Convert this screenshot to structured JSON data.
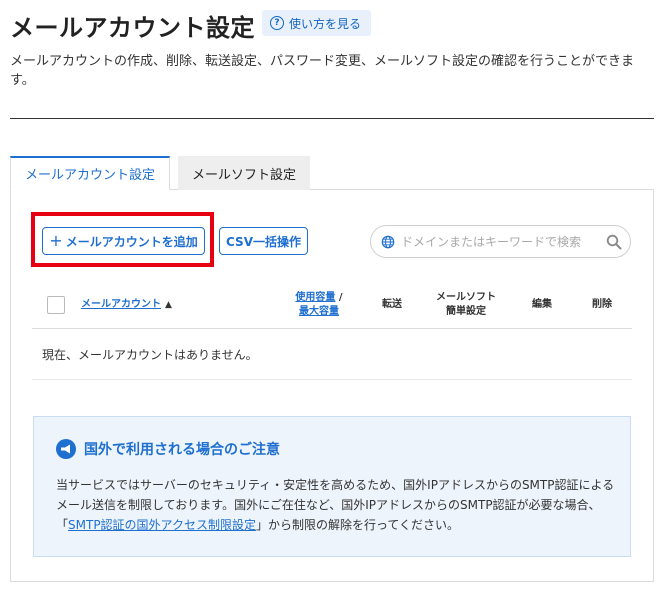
{
  "header": {
    "title": "メールアカウント設定",
    "help_label": "使い方を見る",
    "description": "メールアカウントの作成、削除、転送設定、パスワード変更、メールソフト設定の確認を行うことができます。"
  },
  "tabs": [
    {
      "label": "メールアカウント設定",
      "active": true
    },
    {
      "label": "メールソフト設定",
      "active": false
    }
  ],
  "toolbar": {
    "add_label": "メールアカウントを追加",
    "csv_label": "CSV一括操作",
    "search_placeholder": "ドメインまたはキーワードで検索"
  },
  "table": {
    "col_account": "メールアカウント",
    "sort_indicator": "▲",
    "col_usage_1": "使用容量",
    "col_usage_sep": " /",
    "col_usage_2": "最大容量",
    "col_forward": "転送",
    "col_soft_1": "メールソフト",
    "col_soft_2": "簡単設定",
    "col_edit": "編集",
    "col_delete": "削除",
    "empty_message": "現在、メールアカウントはありません。"
  },
  "notice": {
    "title": "国外で利用される場合のご注意",
    "body_before": "当サービスではサーバーのセキュリティ・安定性を高めるため、国外IPアドレスからのSMTP認証によるメール送信を制限しております。国外にご在住など、国外IPアドレスからのSMTP認証が必要な場合、「",
    "link_label": "SMTP認証の国外アクセス制限設定",
    "body_after": "」から制限の解除を行ってください。"
  },
  "colors": {
    "accent": "#1e6fd0",
    "highlight": "#e60012",
    "notice_bg": "#eef4fb"
  }
}
